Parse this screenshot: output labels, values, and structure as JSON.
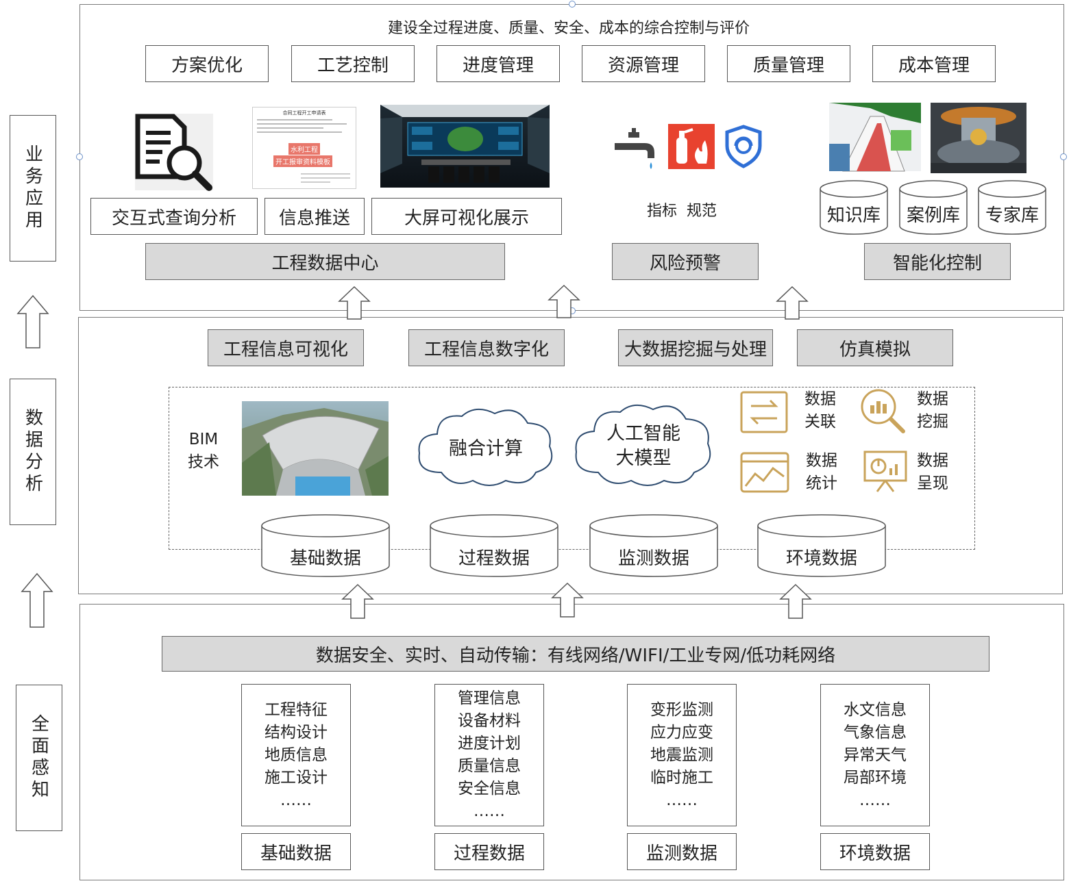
{
  "side_labels": {
    "business": "业务应用",
    "analysis": "数据分析",
    "perception": "全面感知"
  },
  "business": {
    "title": "建设全过程进度、质量、安全、成本的综合控制与评价",
    "top_boxes": [
      "方案优化",
      "工艺控制",
      "进度管理",
      "资源管理",
      "质量管理",
      "成本管理"
    ],
    "doc_thumbnail": {
      "title": "合同工程开工申请表",
      "tag1": "水利工程",
      "tag2": "开工报审资料模板"
    },
    "mid_boxes": [
      "交互式查询分析",
      "信息推送",
      "大屏可视化展示"
    ],
    "standards_label": "指标  规范",
    "repos": [
      "知识库",
      "案例库",
      "专家库"
    ],
    "bottom_boxes": [
      "工程数据中心",
      "风险预警",
      "智能化控制"
    ]
  },
  "analysis": {
    "top_boxes": [
      "工程信息可视化",
      "工程信息数字化",
      "大数据挖掘与处理",
      "仿真模拟"
    ],
    "bim_label": "BIM\n技术",
    "cloud1": "融合计算",
    "cloud2": "人工智能\n大模型",
    "data_tools": [
      {
        "icon": "data-association-icon",
        "label": "数据\n关联"
      },
      {
        "icon": "data-mining-icon",
        "label": "数据\n挖掘"
      },
      {
        "icon": "data-statistics-icon",
        "label": "数据\n统计"
      },
      {
        "icon": "data-presentation-icon",
        "label": "数据\n呈现"
      }
    ],
    "databases": [
      "基础数据",
      "过程数据",
      "监测数据",
      "环境数据"
    ]
  },
  "perception": {
    "network_bar": "数据安全、实时、自动传输：有线网络/WIFI/工业专网/低功耗网络",
    "columns": [
      {
        "items": [
          "工程特征",
          "结构设计",
          "地质信息",
          "施工设计",
          "……"
        ],
        "label": "基础数据"
      },
      {
        "items": [
          "管理信息",
          "设备材料",
          "进度计划",
          "质量信息",
          "安全信息",
          "……"
        ],
        "label": "过程数据"
      },
      {
        "items": [
          "变形监测",
          "应力应变",
          "地震监测",
          "临时施工",
          "……"
        ],
        "label": "监测数据"
      },
      {
        "items": [
          "水文信息",
          "气象信息",
          "异常天气",
          "局部环境",
          "……"
        ],
        "label": "环境数据"
      }
    ]
  },
  "colors": {
    "gray_fill": "#d9d9d9",
    "border": "#555555",
    "icon_gold": "#c9a35a",
    "fire_red": "#e8422f",
    "shield_blue": "#2f6fd6"
  }
}
